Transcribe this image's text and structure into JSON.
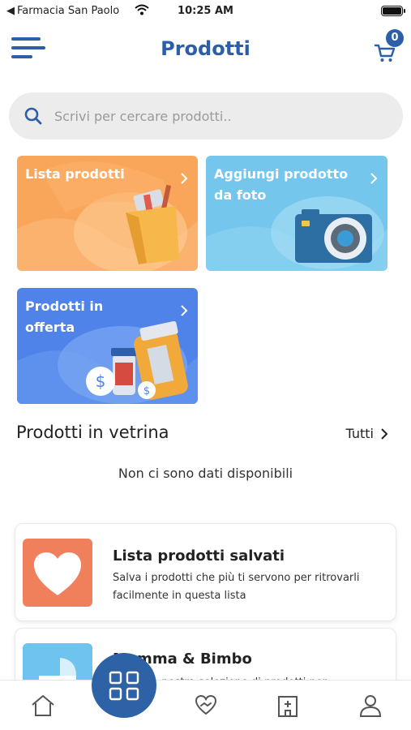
{
  "status_bar": {
    "back_app": "Farmacia San Paolo",
    "time": "10:25 AM"
  },
  "header": {
    "title": "Prodotti",
    "cart_count": "0",
    "menu_icon": "menu-icon",
    "cart_icon": "cart-icon"
  },
  "search": {
    "placeholder": "Scrivi per cercare prodotti..",
    "icon": "search-icon"
  },
  "categories": [
    {
      "label": "Lista prodotti",
      "color": "#f9a65a",
      "icon": "shopping-bag-illustration"
    },
    {
      "label": "Aggiungi prodotto da foto",
      "color": "#74c6ec",
      "icon": "camera-illustration"
    },
    {
      "label": "Prodotti in offerta",
      "color": "#4f83ea",
      "icon": "medicine-bottles-illustration"
    }
  ],
  "showcase": {
    "title": "Prodotti in vetrina",
    "see_all": "Tutti",
    "empty_message": "Non ci sono dati disponibili"
  },
  "features": [
    {
      "title": "Lista prodotti salvati",
      "description": "Salva i prodotti che più ti servono per ritrovarli facilmente in questa lista",
      "icon": "heart-icon",
      "color": "#f07f5c"
    },
    {
      "title": "Mamma & Bimbo",
      "description": "Scopri la nostra selezione di prodotti per",
      "icon": "stroller-icon",
      "color": "#6ec3ef"
    }
  ],
  "tabbar": {
    "items": [
      "home-icon",
      "catalog-grid-icon",
      "heart-hands-icon",
      "pharmacy-icon",
      "profile-icon"
    ],
    "active": "catalog-grid-icon",
    "accent": "#2d62a6"
  }
}
